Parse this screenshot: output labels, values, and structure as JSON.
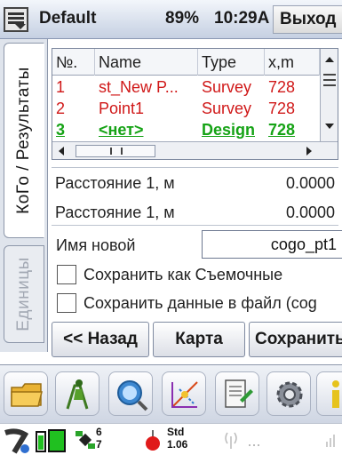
{
  "titlebar": {
    "profile": "Default",
    "battery": "89%",
    "time": "10:29A",
    "exit_label": "Выход"
  },
  "side_tabs": {
    "active": "КоГо / Результаты",
    "inactive": "Единицы"
  },
  "table": {
    "headers": [
      "№.",
      "Name",
      "Type",
      "x,m"
    ],
    "rows": [
      {
        "no": "1",
        "name": "st_New P...",
        "type": "Survey",
        "x": "728",
        "color": "red"
      },
      {
        "no": "2",
        "name": "Point1",
        "type": "Survey",
        "x": "728",
        "color": "red"
      },
      {
        "no": "3",
        "name": "<нет>",
        "type": "Design",
        "x": "728",
        "color": "green"
      }
    ]
  },
  "distances": [
    {
      "label": "Расстояние 1, м",
      "value": "0.0000"
    },
    {
      "label": "Расстояние 1, м",
      "value": "0.0000"
    }
  ],
  "new_name": {
    "label": "Имя новой",
    "value": "cogo_pt1"
  },
  "checkboxes": {
    "save_as_survey": "Сохранить как Съемочные",
    "save_to_file": "Сохранить данные в файл (cog"
  },
  "buttons": {
    "back": "<< Назад",
    "map": "Карта",
    "save": "Сохранить"
  },
  "statusbar": {
    "sat_count_top": "6",
    "sat_count_bottom": "7",
    "mode_label": "Std",
    "mode_value": "1.06"
  },
  "colors": {
    "row_red": "#d01818",
    "row_green": "#16a316",
    "titlebar": "#d7dfec"
  },
  "icons": [
    "menu-icon",
    "folder-icon",
    "surveyor-icon",
    "search-icon",
    "cogo-icon",
    "notes-icon",
    "settings-icon",
    "info-icon",
    "gps-receiver-icon",
    "battery-icon",
    "satellite-icon",
    "radio-icon",
    "signal-icon"
  ]
}
